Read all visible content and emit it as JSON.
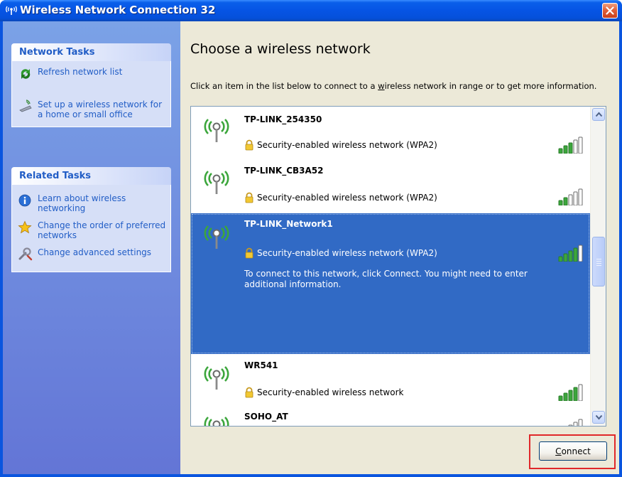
{
  "window": {
    "title": "Wireless Network Connection 32"
  },
  "left_pane": {
    "network_tasks": {
      "header": "Network Tasks",
      "items": [
        {
          "label": "Refresh network list",
          "icon": "refresh-icon"
        },
        {
          "label": "Set up a wireless network for a home or small office",
          "icon": "wireless-setup-icon"
        }
      ]
    },
    "related_tasks": {
      "header": "Related Tasks",
      "items": [
        {
          "label": "Learn about wireless networking",
          "icon": "info-icon"
        },
        {
          "label": "Change the order of preferred networks",
          "icon": "star-icon"
        },
        {
          "label": "Change advanced settings",
          "icon": "settings-icon"
        }
      ]
    }
  },
  "main": {
    "heading": "Choose a wireless network",
    "description_pre": "Click an item in the list below to connect to a ",
    "description_link": "w",
    "description_post": "ireless network in range or to get more information.",
    "networks": [
      {
        "ssid": "TP-LINK_254350",
        "security": "Security-enabled wireless network (WPA2)",
        "signal": 3,
        "selected": false
      },
      {
        "ssid": "TP-LINK_CB3A52",
        "security": "Security-enabled wireless network (WPA2)",
        "signal": 2,
        "selected": false
      },
      {
        "ssid": "TP-LINK_Network1",
        "security": "Security-enabled wireless network (WPA2)",
        "signal": 4,
        "selected": true,
        "detail": "To connect to this network, click Connect. You might need to enter additional information."
      },
      {
        "ssid": "WR541",
        "security": "Security-enabled wireless network",
        "signal": 4,
        "selected": false
      },
      {
        "ssid": "SOHO_AT",
        "security": "",
        "signal": 1,
        "selected": false
      }
    ],
    "connect_label_first": "C",
    "connect_label_rest": "onnect"
  },
  "colors": {
    "title_bar": "#0654E4",
    "task_link": "#215DC6",
    "selection": "#316AC5",
    "highlight_frame": "#E0282A"
  }
}
